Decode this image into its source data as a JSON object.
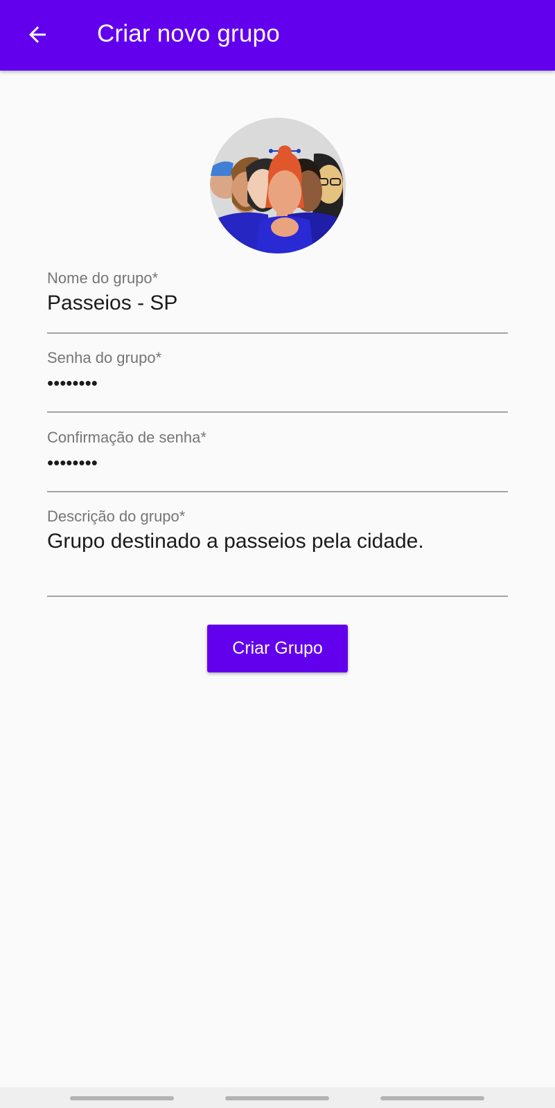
{
  "app_bar": {
    "title": "Criar novo grupo",
    "background_color": "#6200ee",
    "back_icon": "arrow-back-icon"
  },
  "avatar": {
    "icon": "group-people-avatar-icon"
  },
  "form": {
    "name": {
      "label": "Nome do grupo*",
      "value": "Passeios - SP"
    },
    "password": {
      "label": "Senha do grupo*",
      "value": "••••••••"
    },
    "password_confirm": {
      "label": "Confirmação de senha*",
      "value": "••••••••"
    },
    "description": {
      "label": "Descrição do grupo*",
      "value": "Grupo destinado a passeios pela cidade."
    }
  },
  "actions": {
    "create_label": "Criar Grupo",
    "accent_color": "#6200ee"
  }
}
